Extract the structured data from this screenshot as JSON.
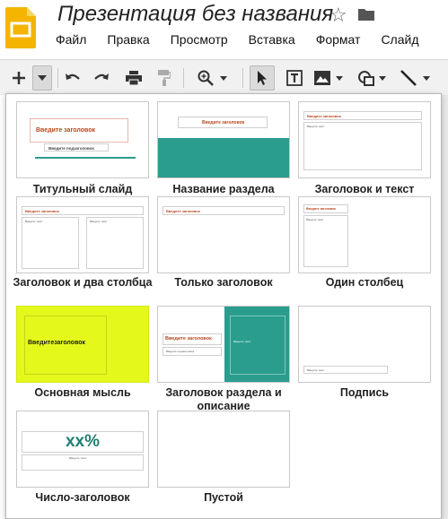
{
  "header": {
    "doc_title": "Презентация без названия",
    "menu": [
      "Файл",
      "Правка",
      "Просмотр",
      "Вставка",
      "Формат",
      "Слайд"
    ]
  },
  "toolbar": {
    "icons": [
      "plus-icon",
      "chevron-down-icon",
      "undo-icon",
      "redo-icon",
      "print-icon",
      "paint-format-icon",
      "zoom-icon",
      "cursor-icon",
      "text-box-icon",
      "image-icon",
      "shape-icon",
      "line-icon"
    ]
  },
  "colors": {
    "accent": "#b8471f",
    "teal": "#2a9d8f",
    "lime": "#e5f81c",
    "logo": "#f4b400"
  },
  "layouts": [
    {
      "caption": "Титульный слайд",
      "thumb_title": "Введите заголовок",
      "thumb_subtitle": "Введите подзаголовок"
    },
    {
      "caption": "Название раздела",
      "thumb_title": "Введите заголовок"
    },
    {
      "caption": "Заголовок и текст",
      "thumb_title": "Введите заголовок",
      "thumb_body": "Введите текст"
    },
    {
      "caption": "Заголовок и два столбца",
      "thumb_title": "Введите заголовок",
      "thumb_body": "Введите текст"
    },
    {
      "caption": "Только заголовок",
      "thumb_title": "Введите заголовок"
    },
    {
      "caption": "Один столбец",
      "thumb_title": "Введите заголовок",
      "thumb_body": "Введите текст"
    },
    {
      "caption": "Основная мысль",
      "thumb_title": "Введитезаголовок"
    },
    {
      "caption": "Заголовок раздела и описание",
      "thumb_title": "Введите заголовок",
      "thumb_subtitle": "Введите подзаголовок",
      "thumb_body": "Введите текст"
    },
    {
      "caption": "Подпись",
      "thumb_body": "Введите текст"
    },
    {
      "caption": "Число-заголовок",
      "thumb_title": "xx%",
      "thumb_body": "Введите текст"
    },
    {
      "caption": "Пустой"
    }
  ]
}
